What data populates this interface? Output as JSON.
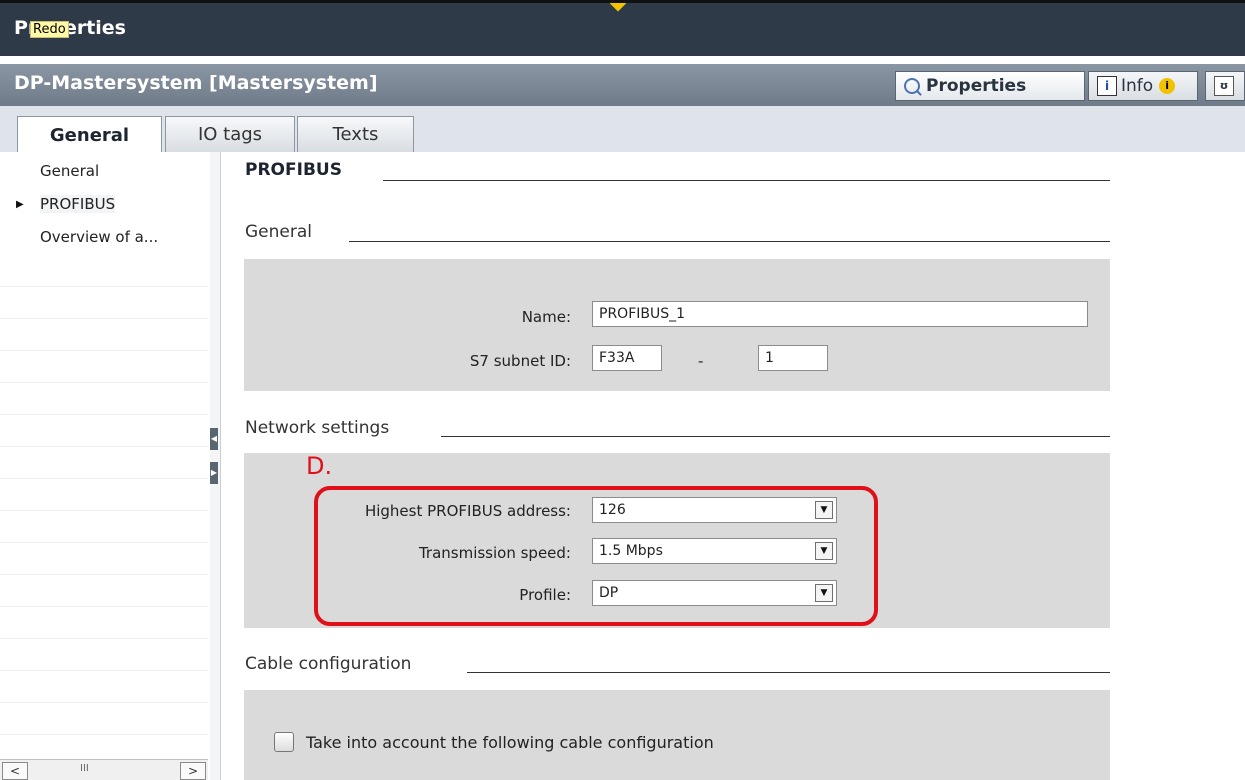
{
  "window": {
    "title": "Properties",
    "tooltip": "Redo"
  },
  "header": {
    "object_title": "DP-Mastersystem [Mastersystem]",
    "properties_tab": "Properties",
    "info_tab": "Info",
    "info_badge": "i"
  },
  "tabs": [
    "General",
    "IO tags",
    "Texts"
  ],
  "nav": {
    "items": [
      "General",
      "PROFIBUS",
      "Overview of a..."
    ],
    "scroll_thumb": "III"
  },
  "sections": {
    "profibus": "PROFIBUS",
    "general": "General",
    "network": "Network settings",
    "cable": "Cable configuration"
  },
  "general_fields": {
    "name_label": "Name:",
    "name_value": "PROFIBUS_1",
    "subnet_label": "S7 subnet ID:",
    "subnet_id_1": "F33A",
    "subnet_dash": "-",
    "subnet_id_2": "1"
  },
  "network_fields": {
    "annotation": "D.",
    "highest_label": "Highest PROFIBUS address:",
    "highest_value": "126",
    "speed_label": "Transmission speed:",
    "speed_value": "1.5 Mbps",
    "profile_label": "Profile:",
    "profile_value": "DP"
  },
  "cable_fields": {
    "checkbox_label": "Take into account the following cable configuration",
    "checked": false
  },
  "colors": {
    "title_bar": "#2f3a49",
    "highlight": "#e0101a",
    "panel": "#dadada"
  }
}
